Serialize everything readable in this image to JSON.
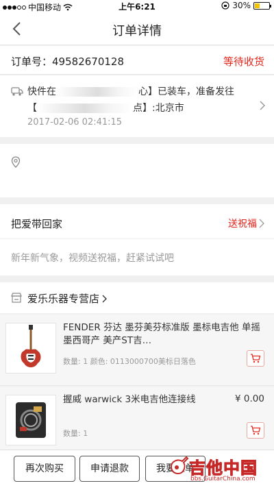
{
  "status_bar": {
    "carrier": "中国移动",
    "time": "上午6:21",
    "battery_percent": "30%",
    "battery_level": 0.3
  },
  "nav": {
    "title": "订单详情"
  },
  "order": {
    "label": "订单号：",
    "number": "49582670128",
    "status": "等待收货"
  },
  "logistics": {
    "line1_prefix": "快件在",
    "line1_suffix": "心】已装车，准备发往",
    "line2_prefix": "【",
    "line2_suffix": "点】:北京市",
    "timestamp": "2017-02-06 02:41:15"
  },
  "gift": {
    "title": "把爱带回家",
    "action": "送祝福",
    "description": "新年新气象，视频送祝福，赶紧试试吧"
  },
  "shop": {
    "name": "爱乐乐器专营店"
  },
  "products": [
    {
      "name": "FENDER 芬达  墨芬美芬标准版 墨标电吉他 单摇墨西哥产 美产ST吉…",
      "price": "",
      "meta": "数量: 1 颜色: 0113000700美标日落色"
    },
    {
      "name": "握威 warwick 3米电吉他连接线",
      "price": "¥ 0.00",
      "meta": "数量: 1"
    }
  ],
  "buttons": {
    "rebuy": "再次购买",
    "refund": "申请退款",
    "third": "我要催单"
  },
  "watermark": {
    "title": "吉他中国",
    "url": "bbs.GuitarChina.com"
  },
  "colors": {
    "accent": "#e1251b"
  }
}
